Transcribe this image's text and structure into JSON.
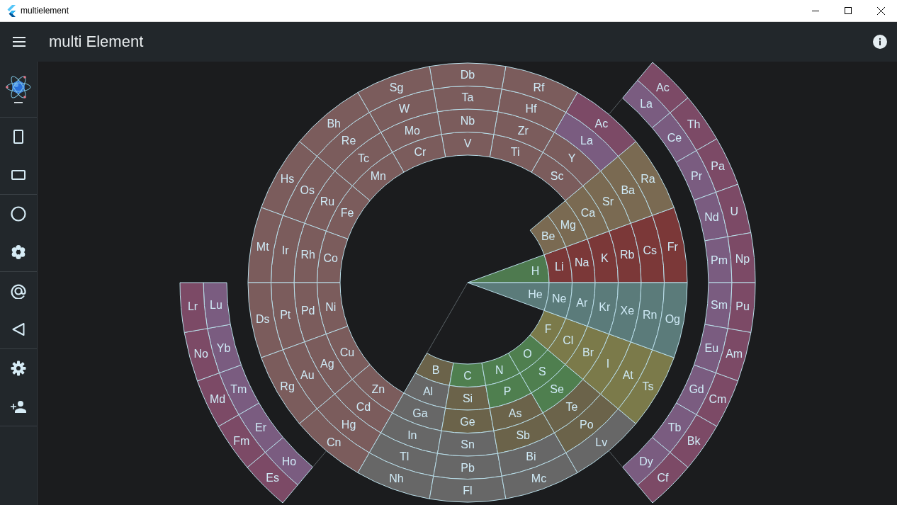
{
  "window": {
    "title": "multielement"
  },
  "app_bar": {
    "title": "multi Element"
  },
  "rings": [
    {
      "elements": [
        {
          "symbol": "H",
          "color": "#4e7a4f"
        },
        {
          "symbol": "He",
          "color": "#5b7b7a"
        }
      ]
    },
    {
      "elements": [
        {
          "symbol": "Li",
          "color": "#7b3838"
        },
        {
          "symbol": "Be",
          "color": "#7a6a52"
        },
        {
          "symbol": "B",
          "color": "#6b634a"
        },
        {
          "symbol": "C",
          "color": "#4f7f4f"
        },
        {
          "symbol": "N",
          "color": "#4f7f4f"
        },
        {
          "symbol": "O",
          "color": "#4f7f4f"
        },
        {
          "symbol": "F",
          "color": "#7b7a4a"
        },
        {
          "symbol": "Ne",
          "color": "#5b7b7a"
        }
      ]
    },
    {
      "elements": [
        {
          "symbol": "Na",
          "color": "#7b3838"
        },
        {
          "symbol": "Mg",
          "color": "#7a6a52"
        },
        {
          "symbol": "Al",
          "color": "#676767"
        },
        {
          "symbol": "Si",
          "color": "#6b634a"
        },
        {
          "symbol": "P",
          "color": "#4f7f4f"
        },
        {
          "symbol": "S",
          "color": "#4f7f4f"
        },
        {
          "symbol": "Cl",
          "color": "#7b7a4a"
        },
        {
          "symbol": "Ar",
          "color": "#5b7b7a"
        }
      ]
    },
    {
      "elements": [
        {
          "symbol": "K",
          "color": "#7b3838"
        },
        {
          "symbol": "Ca",
          "color": "#7a6a52"
        },
        {
          "symbol": "Sc",
          "color": "#7b5c5c"
        },
        {
          "symbol": "Ti",
          "color": "#7b5c5c"
        },
        {
          "symbol": "V",
          "color": "#7b5c5c"
        },
        {
          "symbol": "Cr",
          "color": "#7b5c5c"
        },
        {
          "symbol": "Mn",
          "color": "#7b5c5c"
        },
        {
          "symbol": "Fe",
          "color": "#7b5c5c"
        },
        {
          "symbol": "Co",
          "color": "#7b5c5c"
        },
        {
          "symbol": "Ni",
          "color": "#7b5c5c"
        },
        {
          "symbol": "Cu",
          "color": "#7b5c5c"
        },
        {
          "symbol": "Zn",
          "color": "#7b5c5c"
        },
        {
          "symbol": "Ga",
          "color": "#676767"
        },
        {
          "symbol": "Ge",
          "color": "#6b634a"
        },
        {
          "symbol": "As",
          "color": "#6b634a"
        },
        {
          "symbol": "Se",
          "color": "#4f7f4f"
        },
        {
          "symbol": "Br",
          "color": "#7b7a4a"
        },
        {
          "symbol": "Kr",
          "color": "#5b7b7a"
        }
      ]
    },
    {
      "elements": [
        {
          "symbol": "Rb",
          "color": "#7b3838"
        },
        {
          "symbol": "Sr",
          "color": "#7a6a52"
        },
        {
          "symbol": "Y",
          "color": "#7b5c5c"
        },
        {
          "symbol": "Zr",
          "color": "#7b5c5c"
        },
        {
          "symbol": "Nb",
          "color": "#7b5c5c"
        },
        {
          "symbol": "Mo",
          "color": "#7b5c5c"
        },
        {
          "symbol": "Tc",
          "color": "#7b5c5c"
        },
        {
          "symbol": "Ru",
          "color": "#7b5c5c"
        },
        {
          "symbol": "Rh",
          "color": "#7b5c5c"
        },
        {
          "symbol": "Pd",
          "color": "#7b5c5c"
        },
        {
          "symbol": "Ag",
          "color": "#7b5c5c"
        },
        {
          "symbol": "Cd",
          "color": "#7b5c5c"
        },
        {
          "symbol": "In",
          "color": "#676767"
        },
        {
          "symbol": "Sn",
          "color": "#676767"
        },
        {
          "symbol": "Sb",
          "color": "#6b634a"
        },
        {
          "symbol": "Te",
          "color": "#6b634a"
        },
        {
          "symbol": "I",
          "color": "#7b7a4a"
        },
        {
          "symbol": "Xe",
          "color": "#5b7b7a"
        }
      ]
    },
    {
      "elements": [
        {
          "symbol": "Cs",
          "color": "#7b3838"
        },
        {
          "symbol": "Ba",
          "color": "#7a6a52"
        },
        {
          "symbol": "La",
          "color": "#7a5c80"
        },
        {
          "symbol": "Hf",
          "color": "#7b5c5c"
        },
        {
          "symbol": "Ta",
          "color": "#7b5c5c"
        },
        {
          "symbol": "W",
          "color": "#7b5c5c"
        },
        {
          "symbol": "Re",
          "color": "#7b5c5c"
        },
        {
          "symbol": "Os",
          "color": "#7b5c5c"
        },
        {
          "symbol": "Ir",
          "color": "#7b5c5c"
        },
        {
          "symbol": "Pt",
          "color": "#7b5c5c"
        },
        {
          "symbol": "Au",
          "color": "#7b5c5c"
        },
        {
          "symbol": "Hg",
          "color": "#7b5c5c"
        },
        {
          "symbol": "Tl",
          "color": "#676767"
        },
        {
          "symbol": "Pb",
          "color": "#676767"
        },
        {
          "symbol": "Bi",
          "color": "#676767"
        },
        {
          "symbol": "Po",
          "color": "#6b634a"
        },
        {
          "symbol": "At",
          "color": "#7b7a4a"
        },
        {
          "symbol": "Rn",
          "color": "#5b7b7a"
        }
      ]
    },
    {
      "elements": [
        {
          "symbol": "Fr",
          "color": "#7b3838"
        },
        {
          "symbol": "Ra",
          "color": "#7a6a52"
        },
        {
          "symbol": "Ac",
          "color": "#7c4a66"
        },
        {
          "symbol": "Rf",
          "color": "#7b5c5c"
        },
        {
          "symbol": "Db",
          "color": "#7b5c5c"
        },
        {
          "symbol": "Sg",
          "color": "#7b5c5c"
        },
        {
          "symbol": "Bh",
          "color": "#7b5c5c"
        },
        {
          "symbol": "Hs",
          "color": "#7b5c5c"
        },
        {
          "symbol": "Mt",
          "color": "#7b5c5c"
        },
        {
          "symbol": "Ds",
          "color": "#7b5c5c"
        },
        {
          "symbol": "Rg",
          "color": "#7b5c5c"
        },
        {
          "symbol": "Cn",
          "color": "#7b5c5c"
        },
        {
          "symbol": "Nh",
          "color": "#676767"
        },
        {
          "symbol": "Fl",
          "color": "#676767"
        },
        {
          "symbol": "Mc",
          "color": "#676767"
        },
        {
          "symbol": "Lv",
          "color": "#676767"
        },
        {
          "symbol": "Ts",
          "color": "#7b7a4a"
        },
        {
          "symbol": "Og",
          "color": "#5b7b7a"
        }
      ]
    }
  ],
  "lanthanides": [
    {
      "symbol": "La",
      "color": "#7a5c80"
    },
    {
      "symbol": "Ce",
      "color": "#7a5c80"
    },
    {
      "symbol": "Pr",
      "color": "#7a5c80"
    },
    {
      "symbol": "Nd",
      "color": "#7a5c80"
    },
    {
      "symbol": "Pm",
      "color": "#7a5c80"
    },
    {
      "symbol": "Sm",
      "color": "#7a5c80"
    },
    {
      "symbol": "Eu",
      "color": "#7a5c80"
    },
    {
      "symbol": "Gd",
      "color": "#7a5c80"
    },
    {
      "symbol": "Tb",
      "color": "#7a5c80"
    },
    {
      "symbol": "Dy",
      "color": "#7a5c80"
    },
    {
      "symbol": "Ho",
      "color": "#7a5c80"
    },
    {
      "symbol": "Er",
      "color": "#7a5c80"
    },
    {
      "symbol": "Tm",
      "color": "#7a5c80"
    },
    {
      "symbol": "Yb",
      "color": "#7a5c80"
    },
    {
      "symbol": "Lu",
      "color": "#7a5c80"
    }
  ],
  "actinides": [
    {
      "symbol": "Ac",
      "color": "#7c4a66"
    },
    {
      "symbol": "Th",
      "color": "#7c4a66"
    },
    {
      "symbol": "Pa",
      "color": "#7c4a66"
    },
    {
      "symbol": "U",
      "color": "#7c4a66"
    },
    {
      "symbol": "Np",
      "color": "#7c4a66"
    },
    {
      "symbol": "Pu",
      "color": "#7c4a66"
    },
    {
      "symbol": "Am",
      "color": "#7c4a66"
    },
    {
      "symbol": "Cm",
      "color": "#7c4a66"
    },
    {
      "symbol": "Bk",
      "color": "#7c4a66"
    },
    {
      "symbol": "Cf",
      "color": "#7c4a66"
    },
    {
      "symbol": "Es",
      "color": "#7c4a66"
    },
    {
      "symbol": "Fm",
      "color": "#7c4a66"
    },
    {
      "symbol": "Md",
      "color": "#7c4a66"
    },
    {
      "symbol": "No",
      "color": "#7c4a66"
    },
    {
      "symbol": "Lr",
      "color": "#7c4a66"
    }
  ]
}
